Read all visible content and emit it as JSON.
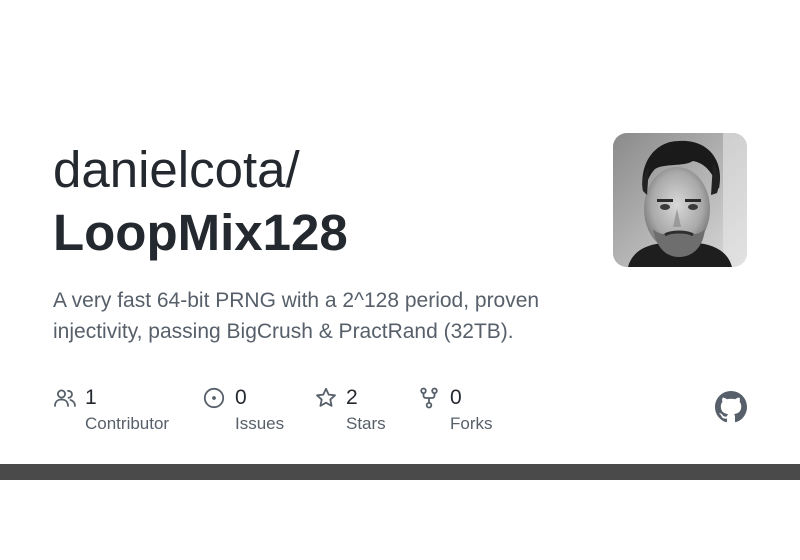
{
  "repo": {
    "owner": "danielcota/",
    "name": "LoopMix128",
    "description": "A very fast 64-bit PRNG with a 2^128 period, proven injectivity, passing BigCrush & PractRand (32TB)."
  },
  "stats": [
    {
      "icon": "people-icon",
      "count": "1",
      "label": "Contributor"
    },
    {
      "icon": "issue-icon",
      "count": "0",
      "label": "Issues"
    },
    {
      "icon": "star-icon",
      "count": "2",
      "label": "Stars"
    },
    {
      "icon": "fork-icon",
      "count": "0",
      "label": "Forks"
    }
  ],
  "brand": {
    "logo": "github-icon",
    "bar_color": "#4a4a4a",
    "text_color": "#24292f",
    "muted_color": "#57606a"
  },
  "avatar": {
    "icon": "avatar-photo"
  }
}
